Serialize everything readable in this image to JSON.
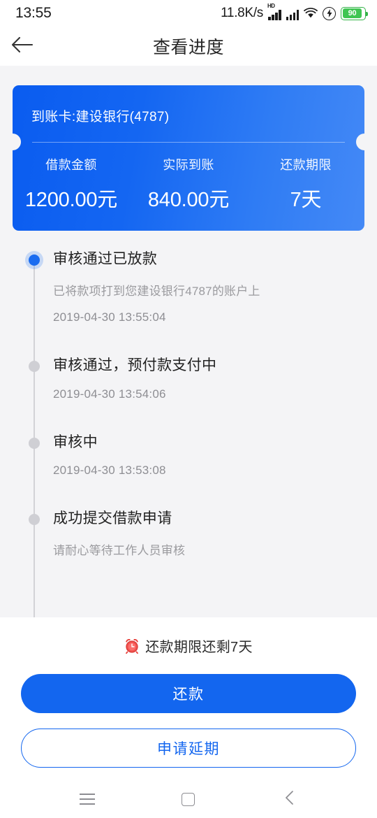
{
  "status_bar": {
    "time": "13:55",
    "net_speed": "11.8K/s",
    "hd_label": "HD",
    "battery_percent": "90",
    "icons": [
      "signal-hd-icon",
      "signal-icon",
      "wifi-icon",
      "flash-charging-icon",
      "battery-icon"
    ]
  },
  "header": {
    "title": "查看进度",
    "back_icon": "back-arrow-icon"
  },
  "loan_card": {
    "bank_line": "到账卡:建设银行(4787)",
    "stats": [
      {
        "label": "借款金额",
        "value": "1200.00元"
      },
      {
        "label": "实际到账",
        "value": "840.00元"
      },
      {
        "label": "还款期限",
        "value": "7天"
      }
    ],
    "gradient_from": "#0a5cf0",
    "gradient_to": "#4489f6"
  },
  "timeline": {
    "items": [
      {
        "title": "审核通过已放款",
        "desc": "已将款项打到您建设银行4787的账户上",
        "time": "2019-04-30 13:55:04",
        "active": true
      },
      {
        "title": "审核通过，预付款支付中",
        "desc": "",
        "time": "2019-04-30 13:54:06",
        "active": false
      },
      {
        "title": "审核中",
        "desc": "",
        "time": "2019-04-30 13:53:08",
        "active": false
      },
      {
        "title": "成功提交借款申请",
        "desc": "请耐心等待工作人员审核",
        "time": "",
        "active": false
      }
    ]
  },
  "bottom_panel": {
    "alarm_icon": "alarm-clock-icon",
    "remain_text": "还款期限还剩7天",
    "primary_button": "还款",
    "outline_button": "申请延期",
    "accent_color": "#1366ef"
  },
  "nav_bar": {
    "recents_icon": "menu-recents-icon",
    "home_icon": "home-square-icon",
    "back_icon": "nav-back-chevron-icon"
  }
}
